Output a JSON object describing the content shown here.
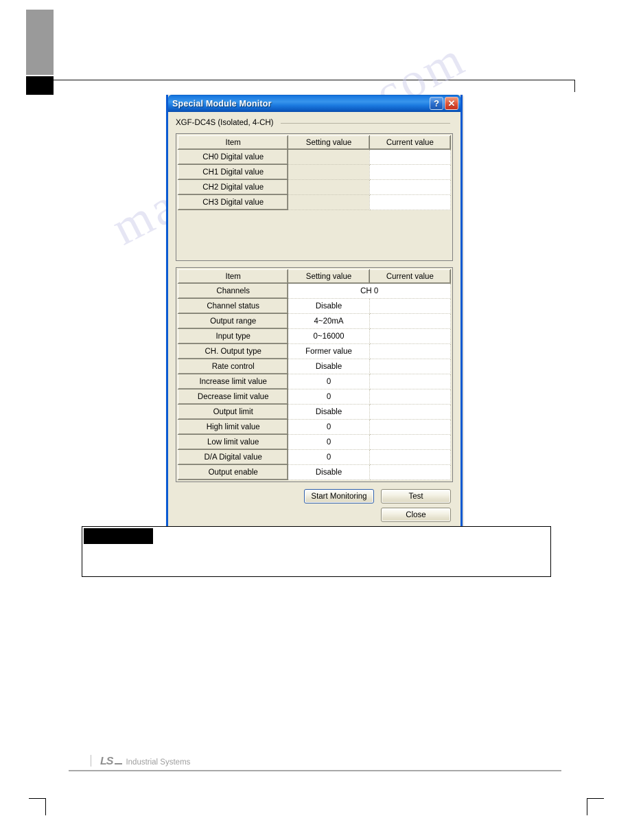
{
  "page": {
    "footer_logo_mark": "LS",
    "footer_company": "Industrial Systems",
    "watermark": "manualshive.com"
  },
  "dialog": {
    "title": "Special Module Monitor",
    "help_button": "?",
    "close_button": "✕",
    "module_name": "XGF-DC4S (Isolated, 4-CH)",
    "columns": [
      "Item",
      "Setting value",
      "Current value"
    ],
    "digital_table": {
      "rows": [
        {
          "item": "CH0 Digital value",
          "setting": "",
          "current": ""
        },
        {
          "item": "CH1 Digital value",
          "setting": "",
          "current": ""
        },
        {
          "item": "CH2 Digital value",
          "setting": "",
          "current": ""
        },
        {
          "item": "CH3 Digital value",
          "setting": "",
          "current": ""
        }
      ]
    },
    "channel_table": {
      "rows": [
        {
          "item": "Channels",
          "setting": "CH 0",
          "current": "",
          "span": true
        },
        {
          "item": "Channel status",
          "setting": "Disable",
          "current": ""
        },
        {
          "item": "Output range",
          "setting": "4~20mA",
          "current": ""
        },
        {
          "item": "Input type",
          "setting": "0~16000",
          "current": ""
        },
        {
          "item": "CH. Output type",
          "setting": "Former value",
          "current": ""
        },
        {
          "item": "Rate control",
          "setting": "Disable",
          "current": ""
        },
        {
          "item": "Increase limit value",
          "setting": "0",
          "current": ""
        },
        {
          "item": "Decrease limit value",
          "setting": "0",
          "current": ""
        },
        {
          "item": "Output limit",
          "setting": "Disable",
          "current": ""
        },
        {
          "item": "High limit value",
          "setting": "0",
          "current": ""
        },
        {
          "item": "Low limit value",
          "setting": "0",
          "current": ""
        },
        {
          "item": "D/A Digital value",
          "setting": "0",
          "current": ""
        },
        {
          "item": "Output enable",
          "setting": "Disable",
          "current": ""
        }
      ]
    },
    "buttons": {
      "start_monitoring": "Start Monitoring",
      "test": "Test",
      "close": "Close"
    }
  }
}
